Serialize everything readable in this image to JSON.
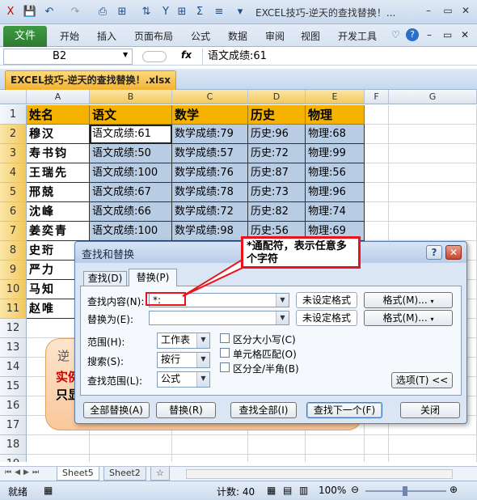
{
  "app": {
    "title": "EXCEL技巧-逆天的查找替换！...",
    "file_tab": "文件",
    "ribbon_tabs": [
      "开始",
      "插入",
      "页面布局",
      "公式",
      "数据",
      "审阅",
      "视图",
      "开发工具"
    ],
    "quick_access": {
      "save": "💾",
      "undo": "↶",
      "redo": "↷",
      "sigma": "Σ"
    }
  },
  "formula_bar": {
    "name_box": "B2",
    "fx": "fx",
    "content": "语文成绩:61"
  },
  "workbook_tab": "EXCEL技巧-逆天的查找替换！.xlsx",
  "columns": [
    "A",
    "B",
    "C",
    "D",
    "E",
    "F",
    "G"
  ],
  "rows": [
    "1",
    "2",
    "3",
    "4",
    "5",
    "6",
    "7",
    "8",
    "9",
    "10",
    "11",
    "12",
    "13",
    "14",
    "15",
    "16",
    "17",
    "18",
    "19",
    "20"
  ],
  "headers": [
    "姓名",
    "语文",
    "数学",
    "历史",
    "物理"
  ],
  "names": [
    "穆汉",
    "寿书钧",
    "王瑞先",
    "邢兢",
    "沈峰",
    "姜奕青",
    "史珩",
    "严力",
    "马知",
    "赵唯"
  ],
  "table": [
    [
      "语文成绩:61",
      "数学成绩:79",
      "历史:96",
      "物理:68"
    ],
    [
      "语文成绩:50",
      "数学成绩:57",
      "历史:72",
      "物理:99"
    ],
    [
      "语文成绩:100",
      "数学成绩:76",
      "历史:87",
      "物理:56"
    ],
    [
      "语文成绩:67",
      "数学成绩:78",
      "历史:73",
      "物理:96"
    ],
    [
      "语文成绩:66",
      "数学成绩:72",
      "历史:82",
      "物理:74"
    ],
    [
      "语文成绩:100",
      "数学成绩:98",
      "历史:56",
      "物理:69"
    ]
  ],
  "callout": {
    "line1": "逆",
    "line2": "实例",
    "line3": "只显"
  },
  "dialog": {
    "title": "查找和替换",
    "tabs": [
      "查找(D)",
      "替换(P)"
    ],
    "find_label": "查找内容(N):",
    "find_value": "*:",
    "replace_label": "替换为(E):",
    "replace_value": "",
    "no_format_1": "未设定格式",
    "no_format_2": "未设定格式",
    "format_1": "格式(M)...",
    "format_2": "格式(M)...",
    "scope_label": "范围(H):",
    "scope_value": "工作表",
    "search_label": "搜索(S):",
    "search_value": "按行",
    "lookin_label": "查找范围(L):",
    "lookin_value": "公式",
    "match_case": "区分大小写(C)",
    "match_cell": "单元格匹配(O)",
    "match_width": "区分全/半角(B)",
    "options": "选项(T) <<",
    "replace_all": "全部替换(A)",
    "replace": "替换(R)",
    "find_all": "查找全部(I)",
    "find_next": "查找下一个(F)",
    "close": "关闭",
    "help": "?",
    "close_x": "✕"
  },
  "annotation": "*通配符，表示任意多个字符",
  "sheets": [
    "Sheet5",
    "Sheet2"
  ],
  "status": {
    "ready": "就绪",
    "count": "计数: 40",
    "zoom": "100%"
  }
}
